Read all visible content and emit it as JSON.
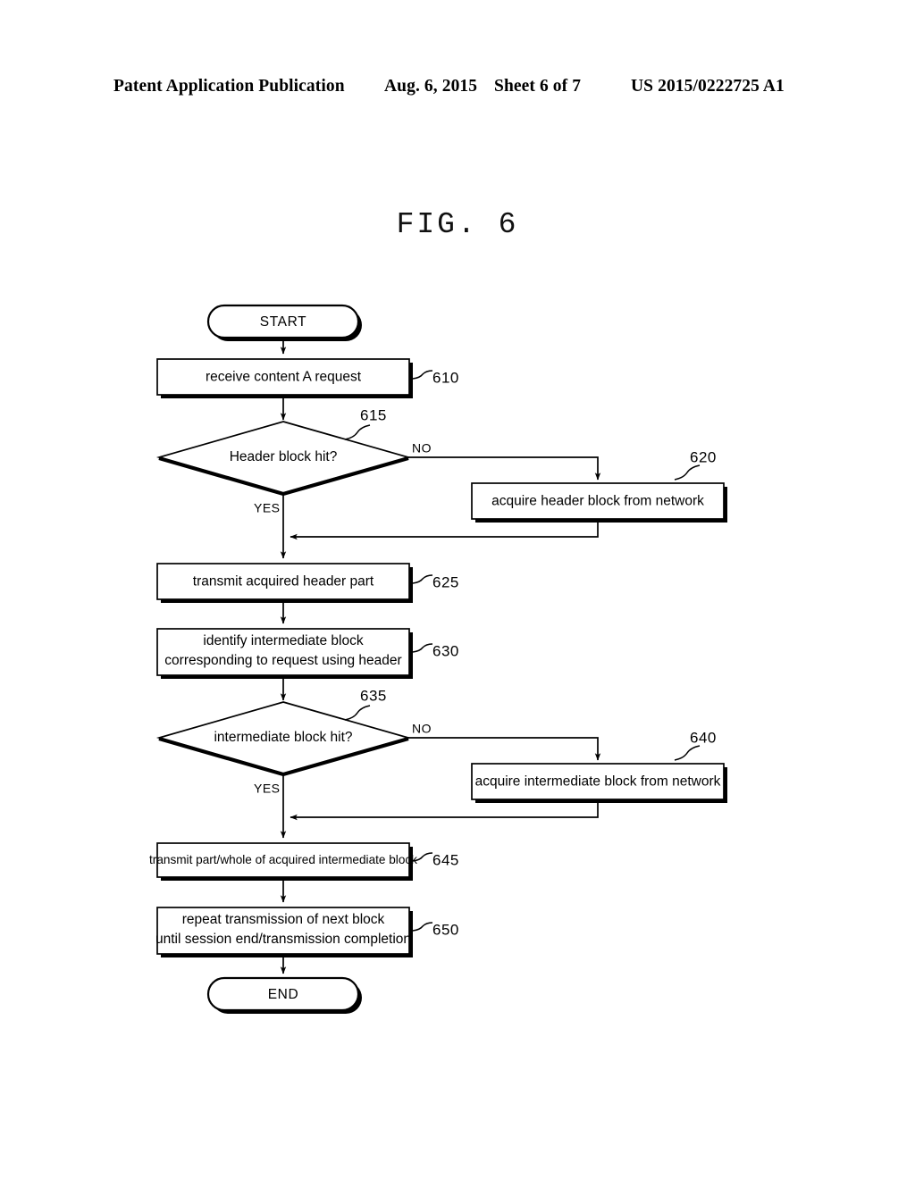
{
  "header": {
    "publication": "Patent Application Publication",
    "date": "Aug. 6, 2015",
    "sheet": "Sheet 6 of 7",
    "number": "US 2015/0222725 A1"
  },
  "figure": {
    "title": "FIG. 6"
  },
  "chart_data": {
    "type": "diagram",
    "diagram_kind": "flowchart",
    "title": "FIG. 6",
    "nodes": [
      {
        "id": "start",
        "shape": "terminator",
        "label": "START",
        "ref": ""
      },
      {
        "id": "n610",
        "shape": "process",
        "label": "receive content A request",
        "ref": "610"
      },
      {
        "id": "d615",
        "shape": "decision",
        "label": "Header block hit?",
        "ref": "615"
      },
      {
        "id": "n620",
        "shape": "process",
        "label": "acquire header block from network",
        "ref": "620"
      },
      {
        "id": "n625",
        "shape": "process",
        "label": "transmit acquired header part",
        "ref": "625"
      },
      {
        "id": "n630",
        "shape": "process",
        "label": "identify intermediate block corresponding to request using header",
        "line1": "identify intermediate block",
        "line2": "corresponding to request using header",
        "ref": "630"
      },
      {
        "id": "d635",
        "shape": "decision",
        "label": "intermediate block hit?",
        "ref": "635"
      },
      {
        "id": "n640",
        "shape": "process",
        "label": "acquire intermediate block from network",
        "ref": "640"
      },
      {
        "id": "n645",
        "shape": "process",
        "label": "transmit part/whole of acquired intermediate block",
        "ref": "645"
      },
      {
        "id": "n650",
        "shape": "process",
        "label": "repeat transmission of next block until session end/transmission completion",
        "line1": "repeat transmission of next block",
        "line2": "until session end/transmission completion",
        "ref": "650"
      },
      {
        "id": "end",
        "shape": "terminator",
        "label": "END",
        "ref": ""
      }
    ],
    "edges": [
      {
        "from": "start",
        "to": "n610",
        "label": ""
      },
      {
        "from": "n610",
        "to": "d615",
        "label": ""
      },
      {
        "from": "d615",
        "to": "n620",
        "label": "NO"
      },
      {
        "from": "d615",
        "to": "n625",
        "label": "YES"
      },
      {
        "from": "n620",
        "to": "n625",
        "label": ""
      },
      {
        "from": "n625",
        "to": "n630",
        "label": ""
      },
      {
        "from": "n630",
        "to": "d635",
        "label": ""
      },
      {
        "from": "d635",
        "to": "n640",
        "label": "NO"
      },
      {
        "from": "d635",
        "to": "n645",
        "label": "YES"
      },
      {
        "from": "n640",
        "to": "n645",
        "label": ""
      },
      {
        "from": "n645",
        "to": "n650",
        "label": ""
      },
      {
        "from": "n650",
        "to": "end",
        "label": ""
      }
    ],
    "branch_labels": {
      "no_615": "NO",
      "yes_615": "YES",
      "no_635": "NO",
      "yes_635": "YES"
    }
  }
}
